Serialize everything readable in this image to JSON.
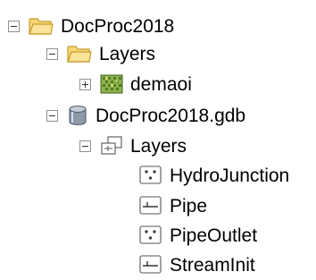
{
  "tree": {
    "root": {
      "label": "DocProc2018",
      "icon": "folder-open-icon",
      "expanded": true
    },
    "layers_group": {
      "label": "Layers",
      "icon": "folder-open-icon",
      "expanded": true
    },
    "raster": {
      "label": "demaoi",
      "icon": "raster-dataset-icon",
      "expanded": false
    },
    "geodatabase": {
      "label": "DocProc2018.gdb",
      "icon": "geodatabase-icon",
      "expanded": true
    },
    "feature_dataset": {
      "label": "Layers",
      "icon": "feature-dataset-icon",
      "expanded": true
    },
    "feature_classes": [
      {
        "label": "HydroJunction",
        "icon": "point-feature-class-icon"
      },
      {
        "label": "Pipe",
        "icon": "line-feature-class-icon"
      },
      {
        "label": "PipeOutlet",
        "icon": "point-feature-class-icon"
      },
      {
        "label": "StreamInit",
        "icon": "line-feature-class-icon"
      }
    ]
  },
  "colors": {
    "folder_fill": "#f8d775",
    "folder_stroke": "#c49a2a",
    "geodatabase": "#6f7f90",
    "raster_green": "#4f7d2b",
    "expander_border": "#919191"
  }
}
